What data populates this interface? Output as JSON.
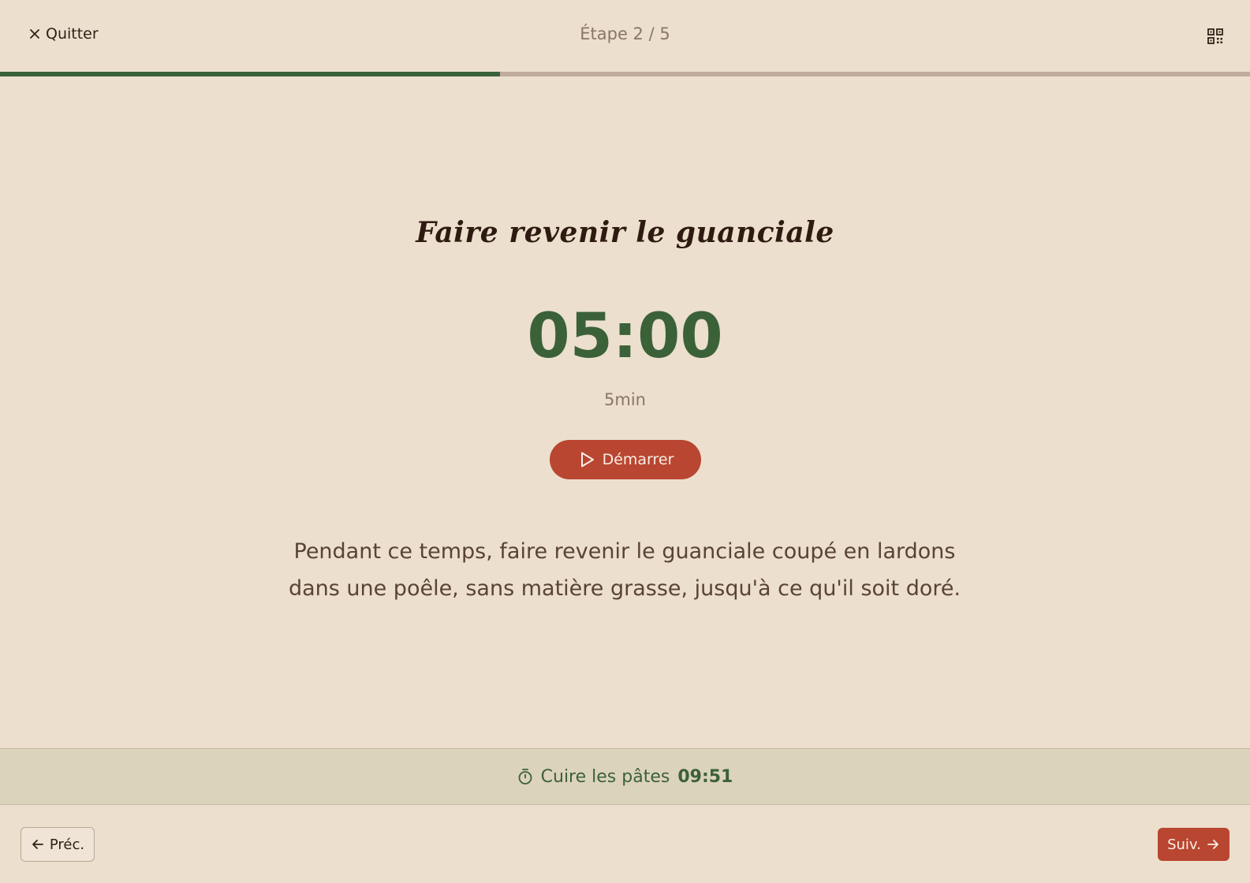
{
  "header": {
    "quit_label": "Quitter",
    "quit_icon": "close-icon",
    "step_counter": "Étape 2 / 5",
    "qr_icon": "qr-code-icon"
  },
  "progress": {
    "fraction": 0.4,
    "fill_color": "#3a613a",
    "track_color": "#bfac9c"
  },
  "step": {
    "title": "Faire revenir le guanciale",
    "timer_display": "05:00",
    "timer_duration": "5min",
    "start_label": "Démarrer",
    "start_icon": "play-icon",
    "instructions": "Pendant ce temps, faire revenir le guanciale coupé en lardons dans une poêle, sans matière grasse, jusqu'à ce qu'il soit doré."
  },
  "active_timer": {
    "icon": "stopwatch-icon",
    "label": "Cuire les pâtes",
    "time": "09:51"
  },
  "footer": {
    "prev_label": "Préc.",
    "prev_icon": "arrow-left-icon",
    "next_label": "Suiv.",
    "next_icon": "arrow-right-icon"
  },
  "colors": {
    "background": "#ecdfcd",
    "accent": "#b94631",
    "green": "#3b6139",
    "timer_bar_bg": "#dcd3bc"
  }
}
